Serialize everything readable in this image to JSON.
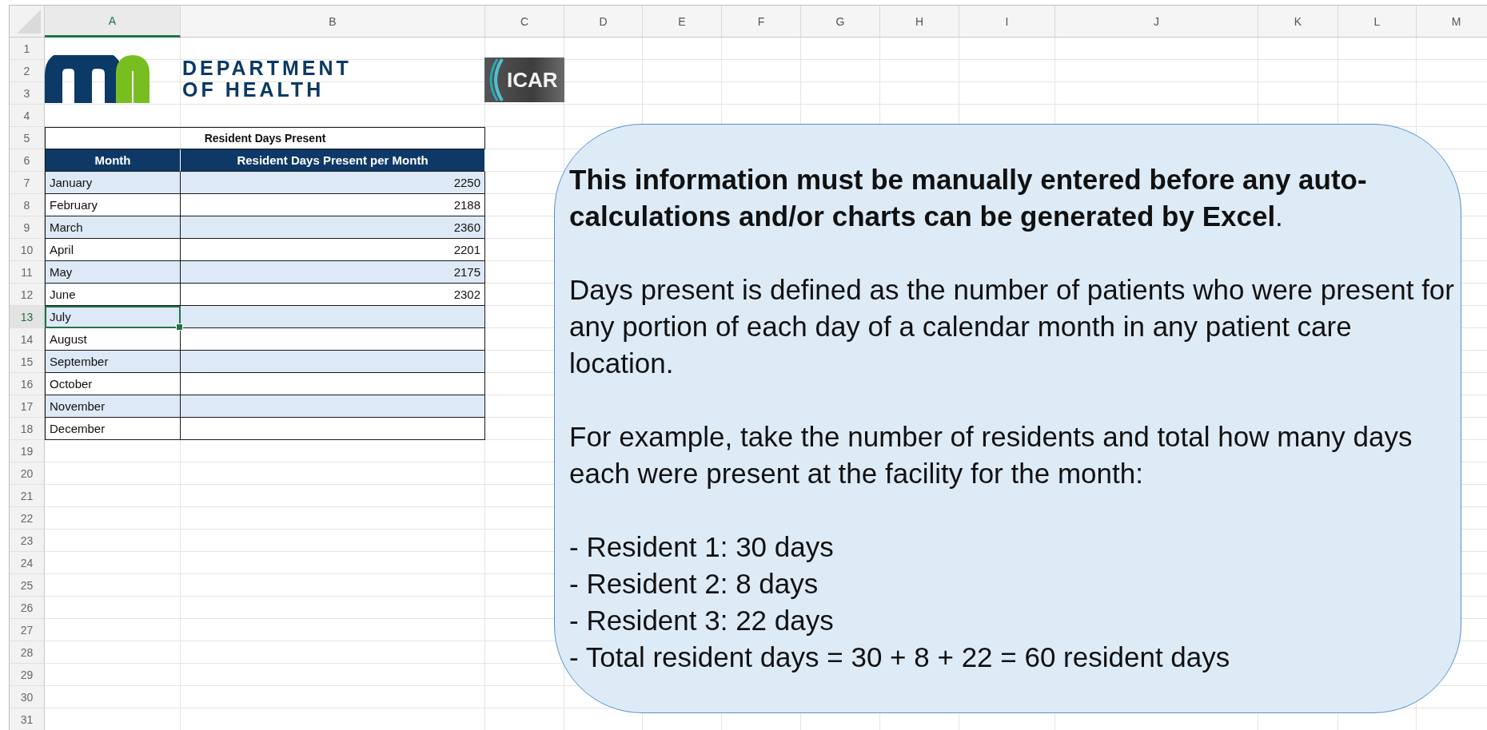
{
  "sheet": {
    "columns": [
      {
        "label": "A",
        "selected": true
      },
      {
        "label": "B",
        "selected": false
      },
      {
        "label": "C",
        "selected": false
      },
      {
        "label": "D",
        "selected": false
      },
      {
        "label": "E",
        "selected": false
      },
      {
        "label": "F",
        "selected": false
      },
      {
        "label": "G",
        "selected": false
      },
      {
        "label": "H",
        "selected": false
      },
      {
        "label": "I",
        "selected": false
      },
      {
        "label": "J",
        "selected": false
      },
      {
        "label": "K",
        "selected": false
      },
      {
        "label": "L",
        "selected": false
      },
      {
        "label": "M",
        "selected": false
      }
    ],
    "rows": [
      {
        "label": "1",
        "selected": false
      },
      {
        "label": "2",
        "selected": false
      },
      {
        "label": "3",
        "selected": false
      },
      {
        "label": "4",
        "selected": false
      },
      {
        "label": "5",
        "selected": false
      },
      {
        "label": "6",
        "selected": false
      },
      {
        "label": "7",
        "selected": false
      },
      {
        "label": "8",
        "selected": false
      },
      {
        "label": "9",
        "selected": false
      },
      {
        "label": "10",
        "selected": false
      },
      {
        "label": "11",
        "selected": false
      },
      {
        "label": "12",
        "selected": false
      },
      {
        "label": "13",
        "selected": true
      },
      {
        "label": "14",
        "selected": false
      },
      {
        "label": "15",
        "selected": false
      },
      {
        "label": "16",
        "selected": false
      },
      {
        "label": "17",
        "selected": false
      },
      {
        "label": "18",
        "selected": false
      },
      {
        "label": "19",
        "selected": false
      },
      {
        "label": "20",
        "selected": false
      },
      {
        "label": "21",
        "selected": false
      },
      {
        "label": "22",
        "selected": false
      },
      {
        "label": "23",
        "selected": false
      },
      {
        "label": "24",
        "selected": false
      },
      {
        "label": "25",
        "selected": false
      },
      {
        "label": "26",
        "selected": false
      },
      {
        "label": "27",
        "selected": false
      },
      {
        "label": "28",
        "selected": false
      },
      {
        "label": "29",
        "selected": false
      },
      {
        "label": "30",
        "selected": false
      },
      {
        "label": "31",
        "selected": false
      }
    ]
  },
  "logo": {
    "lines": [
      "DEPARTMENT",
      "OF HEALTH"
    ]
  },
  "badge": {
    "text": "ICAR"
  },
  "table": {
    "title": "Resident Days Present",
    "columns": [
      "Month",
      "Resident Days Present per Month"
    ],
    "rows": [
      {
        "month": "January",
        "days": "2250",
        "selected": false
      },
      {
        "month": "February",
        "days": "2188",
        "selected": false
      },
      {
        "month": "March",
        "days": "2360",
        "selected": false
      },
      {
        "month": "April",
        "days": "2201",
        "selected": false
      },
      {
        "month": "May",
        "days": "2175",
        "selected": false
      },
      {
        "month": "June",
        "days": "2302",
        "selected": false
      },
      {
        "month": "July",
        "selected": true
      },
      {
        "month": "August",
        "selected": false
      },
      {
        "month": "September",
        "selected": false
      },
      {
        "month": "October",
        "selected": false
      },
      {
        "month": "November",
        "selected": false
      },
      {
        "month": "December",
        "selected": false
      }
    ]
  },
  "callout": {
    "paragraphs": [
      "**This information must be manually entered before any auto-calculations and/or charts can be generated by Excel**.",
      "Days present is defined as the number of patients who were present for any portion of each day of a calendar month in any patient care location.",
      "For example, take the number of residents and total how many days each were present at the facility for the month:"
    ],
    "list": [
      "- Resident 1: 30 days",
      "- Resident 2: 8 days",
      "- Resident 3: 22 days",
      "- Total resident days = 30 + 8 + 22 = 60 resident days"
    ]
  }
}
